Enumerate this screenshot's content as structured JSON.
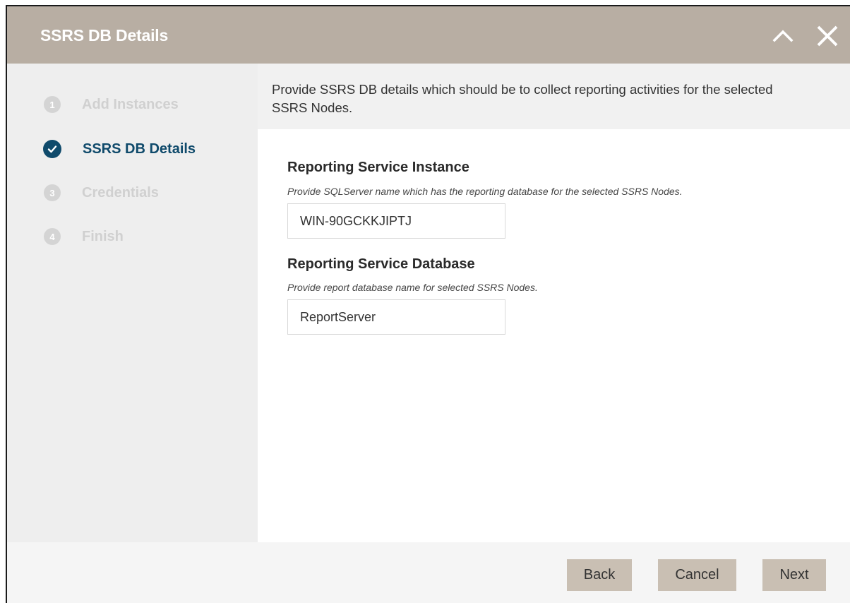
{
  "dialog": {
    "title": "SSRS DB Details"
  },
  "header_controls": {
    "collapse_icon": "chevron-up-icon",
    "close_icon": "close-icon"
  },
  "steps": [
    {
      "number": "1",
      "label": "Add Instances",
      "state": "inactive"
    },
    {
      "number": "",
      "label": "SSRS DB Details",
      "state": "active"
    },
    {
      "number": "3",
      "label": "Credentials",
      "state": "inactive"
    },
    {
      "number": "4",
      "label": "Finish",
      "state": "inactive"
    }
  ],
  "description": "Provide SSRS DB details which should be to collect reporting activities for the selected SSRS Nodes.",
  "fields": {
    "instance": {
      "title": "Reporting Service Instance",
      "help": "Provide SQLServer name which has the reporting database for the selected SSRS Nodes.",
      "value": "WIN-90GCKKJIPTJ"
    },
    "database": {
      "title": "Reporting Service Database",
      "help": "Provide report database name for selected SSRS Nodes.",
      "value": "ReportServer"
    }
  },
  "footer": {
    "back_label": "Back",
    "cancel_label": "Cancel",
    "next_label": "Next"
  },
  "colors": {
    "header_bg": "#b8aea3",
    "active_step": "#0f4a6b",
    "button_bg": "#c9bfb3"
  }
}
